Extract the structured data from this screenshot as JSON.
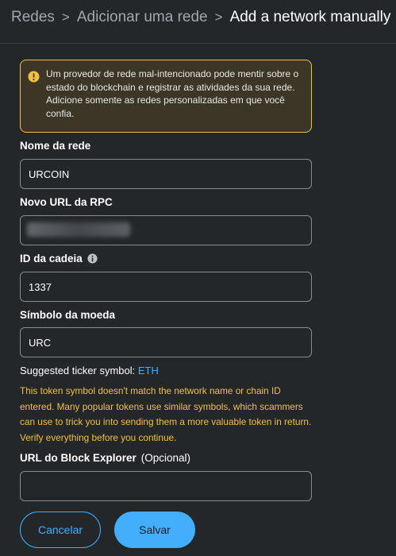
{
  "breadcrumb": {
    "items": [
      "Redes",
      "Adicionar uma rede"
    ],
    "current": "Add a network manually",
    "separator": ">"
  },
  "warning": {
    "text": "Um provedor de rede mal-intencionado pode mentir sobre o estado do blockchain e registrar as atividades da sua rede. Adicione somente as redes personalizadas em que você confia.",
    "icon": "info-circle-icon"
  },
  "form": {
    "network_name": {
      "label": "Nome da rede",
      "value": "URCOIN"
    },
    "rpc_url": {
      "label": "Novo URL da RPC",
      "value": ""
    },
    "chain_id": {
      "label": "ID da cadeia",
      "value": "1337"
    },
    "currency_symbol": {
      "label": "Símbolo da moeda",
      "value": "URC"
    },
    "block_explorer": {
      "label": "URL do Block Explorer",
      "optional": "(Opcional)",
      "value": ""
    }
  },
  "suggestion": {
    "label": "Suggested ticker symbol:",
    "symbol": "ETH"
  },
  "token_warning": "This token symbol doesn't match the network name or chain ID entered. Many popular tokens use similar symbols, which scammers can use to trick you into sending them a more valuable token in return. Verify everything before you continue.",
  "buttons": {
    "cancel": "Cancelar",
    "save": "Salvar"
  },
  "colors": {
    "background": "#24272a",
    "accent": "#43aefc",
    "warning": "#f0c040"
  }
}
